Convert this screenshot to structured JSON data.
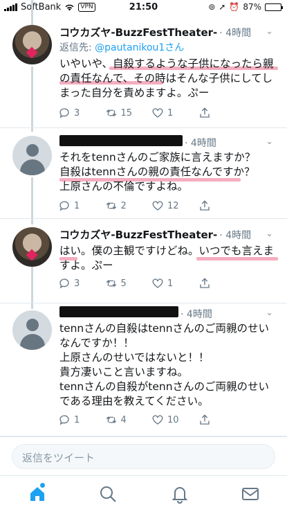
{
  "status_bar": {
    "carrier": "SoftBank",
    "vpn": "VPN",
    "time": "21:50",
    "battery": "87%",
    "battery_level": 0.87
  },
  "tweets": [
    {
      "name": "コウカズヤ-BuzzFestTheater-",
      "time": "4時間",
      "reply_label": "返信先:",
      "reply_handle": "@pautanikou1さん",
      "lines": [
        "いやいや、自殺するような子供になったら親",
        "の責任なんで、その時はそんな子供にしてし",
        "まった自分を責めますよ。ぷー"
      ],
      "replies": "3",
      "retweets": "15",
      "likes": "1"
    },
    {
      "name": "",
      "time": "4時間",
      "lines": [
        "それをtennさんのご家族に言えますか？",
        "自殺はtennさんの親の責任なんですか？",
        "上原さんの不倫ですよね。"
      ],
      "replies": "1",
      "retweets": "2",
      "likes": "12"
    },
    {
      "name": "コウカズヤ-BuzzFestTheater-",
      "time": "4時間",
      "lines": [
        "はい。僕の主観ですけどね。いつでも言えま",
        "すよ。ぷー"
      ],
      "replies": "3",
      "retweets": "5",
      "likes": "1"
    },
    {
      "name": "",
      "time": "4時間",
      "lines": [
        "tennさんの自殺はtennさんのご両親のせい",
        "なんですか！！",
        "上原さんのせいではないと！！",
        "貴方凄いこと言いますね。",
        "tennさんの自殺がtennさんのご両親のせい",
        "である理由を教えてください。"
      ],
      "replies": "1",
      "retweets": "4",
      "likes": "10"
    }
  ],
  "reply_bar": {
    "placeholder": "返信をツイート"
  },
  "tabs": [
    "home",
    "search",
    "notifications",
    "messages"
  ],
  "colors": {
    "accent": "#1da1f2",
    "highlight": "#f2a0b4",
    "muted": "#657786"
  }
}
